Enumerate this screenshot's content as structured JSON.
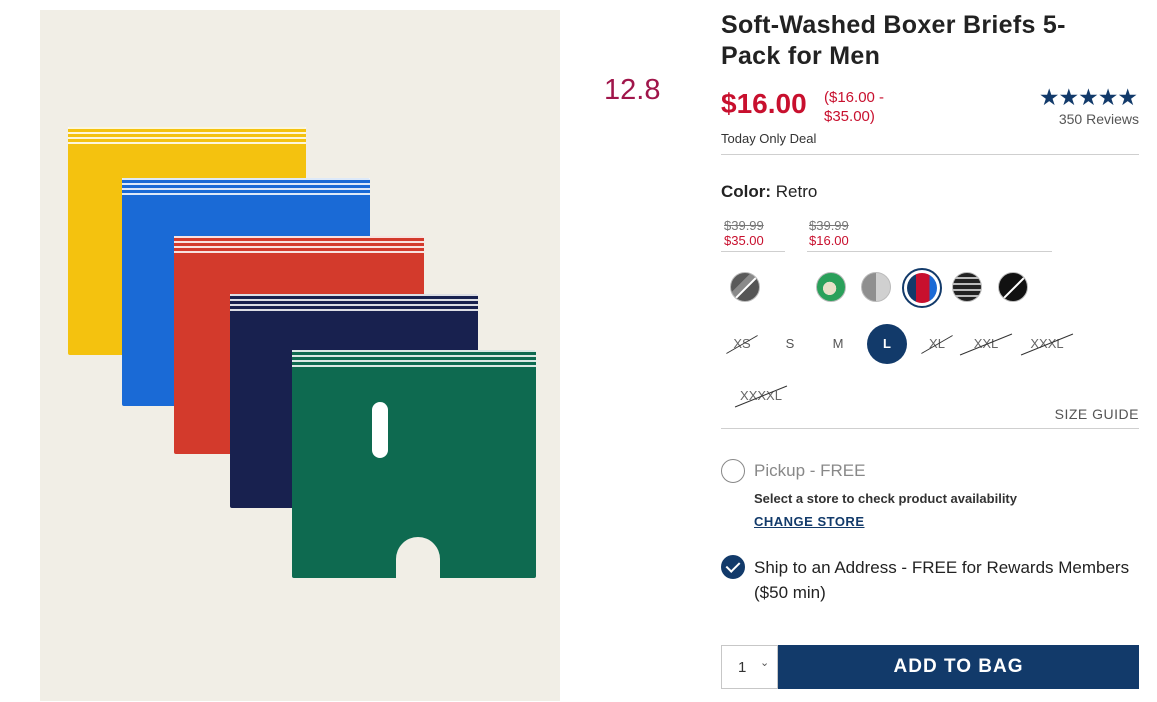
{
  "badge": "12.8",
  "product": {
    "title": "Soft-Washed Boxer Briefs 5-Pack for Men",
    "sale_price": "$16.00",
    "price_range_open": "(",
    "price_range": "$16.00 - $35.00",
    "price_range_close": ")",
    "deal_text": "Today Only Deal",
    "rating_stars": "★★★★★",
    "rating_value": 5,
    "reviews": "350 Reviews"
  },
  "color": {
    "label": "Color:",
    "value": "Retro",
    "groups": [
      {
        "was": "$39.99",
        "now": "$35.00"
      },
      {
        "was": "$39.99",
        "now": "$16.00"
      }
    ],
    "swatches": [
      {
        "name": "gray-camo",
        "colors": [
          "#5a5a5a",
          "#8a8a8a"
        ],
        "unavailable": true
      },
      {
        "name": "green-pattern",
        "colors": [
          "#2aa05a",
          "#e8e0c8"
        ]
      },
      {
        "name": "gray-heather",
        "colors": [
          "#9a9a9a",
          "#d0d0d0"
        ]
      },
      {
        "name": "retro",
        "colors": [
          "#c8102e",
          "#123a6a"
        ],
        "selected": true
      },
      {
        "name": "black-stripe",
        "colors": [
          "#222222",
          "#bbbbbb"
        ]
      },
      {
        "name": "black",
        "colors": [
          "#111111",
          "#111111"
        ],
        "unavailable": true
      }
    ]
  },
  "sizes": [
    {
      "label": "XS",
      "available": false
    },
    {
      "label": "S",
      "available": true
    },
    {
      "label": "M",
      "available": true
    },
    {
      "label": "L",
      "available": true,
      "selected": true
    },
    {
      "label": "XL",
      "available": false
    },
    {
      "label": "XXL",
      "available": false
    },
    {
      "label": "XXXL",
      "available": false
    },
    {
      "label": "XXXXL",
      "available": false
    }
  ],
  "size_guide": "SIZE GUIDE",
  "fulfillment": {
    "pickup_label": "Pickup - FREE",
    "pickup_note": "Select a store to check product availability",
    "change_store": "CHANGE STORE",
    "ship_label": "Ship to an Address - FREE for Rewards Members ($50 min)",
    "ship_selected": true
  },
  "quantity": "1",
  "add_to_bag": "ADD TO BAG",
  "colors": {
    "accent": "#123a6a",
    "sale": "#c8102e",
    "badge": "#a0154a"
  }
}
